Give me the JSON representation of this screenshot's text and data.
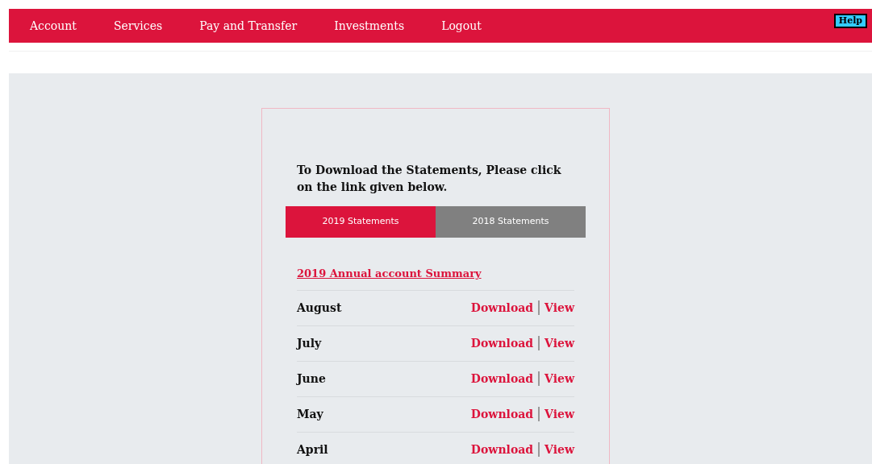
{
  "nav": {
    "items": [
      "Account",
      "Services",
      "Pay and Transfer",
      "Investments",
      "Logout"
    ],
    "help": "Help"
  },
  "statements": {
    "heading": "To Download the Statements, Please click on the link given below.",
    "tabs": [
      {
        "label": "2019 Statements",
        "selected": true
      },
      {
        "label": "2018 Statements",
        "selected": false
      }
    ],
    "summary_link": "2019 Annual account Summary",
    "rows": [
      {
        "month": "August",
        "download": "Download",
        "view": "View"
      },
      {
        "month": "July",
        "download": "Download",
        "view": "View"
      },
      {
        "month": "June",
        "download": "Download",
        "view": "View"
      },
      {
        "month": "May",
        "download": "Download",
        "view": "View"
      },
      {
        "month": "April",
        "download": "Download",
        "view": "View"
      }
    ]
  }
}
